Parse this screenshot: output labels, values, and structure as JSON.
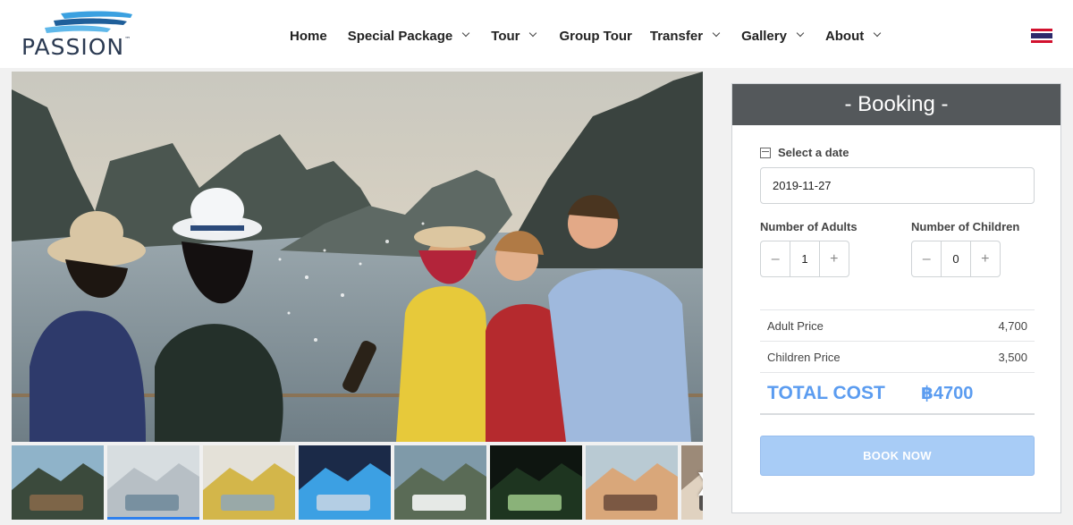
{
  "brand": {
    "name": "PASSION",
    "tm": "™"
  },
  "nav": {
    "items": [
      {
        "label": "Home",
        "dropdown": false,
        "gap": 23
      },
      {
        "label": "Special Package",
        "dropdown": true,
        "gap": 25
      },
      {
        "label": "Tour",
        "dropdown": true,
        "gap": 26
      },
      {
        "label": "Group Tour",
        "dropdown": false,
        "gap": 20
      },
      {
        "label": "Transfer",
        "dropdown": true,
        "gap": 25
      },
      {
        "label": "Gallery",
        "dropdown": true,
        "gap": 25
      },
      {
        "label": "About",
        "dropdown": true,
        "gap": 0
      }
    ],
    "language_icon": "thai-flag-icon"
  },
  "gallery": {
    "hero_icon": "photo-friends-celebrating-on-boat",
    "thumbnails": [
      {
        "icon": "photo-boat-deck-islands",
        "active": false
      },
      {
        "icon": "photo-boat-lounge",
        "active": true
      },
      {
        "icon": "photo-woman-yellow-dress",
        "active": false
      },
      {
        "icon": "photo-party-lights",
        "active": false
      },
      {
        "icon": "photo-yacht-cliffs",
        "active": false
      },
      {
        "icon": "photo-cave-night",
        "active": false
      },
      {
        "icon": "photo-woman-dining",
        "active": false
      },
      {
        "icon": "photo-partial",
        "active": false
      }
    ],
    "next_icon": "chevron-right-icon",
    "next_glyph": "❯"
  },
  "booking": {
    "title": "- Booking -",
    "date": {
      "label": "Select a date",
      "value": "2019-11-27",
      "icon": "calendar-icon"
    },
    "adults": {
      "label": "Number of Adults",
      "value": "1",
      "minus": "–",
      "plus": "+"
    },
    "children": {
      "label": "Number of Children",
      "value": "0",
      "minus": "–",
      "plus": "+"
    },
    "prices": [
      {
        "label": "Adult Price",
        "value": "4,700"
      },
      {
        "label": "Children Price",
        "value": "3,500"
      }
    ],
    "total": {
      "label": "TOTAL COST",
      "value": "฿4700"
    },
    "button": "BOOK NOW"
  },
  "colors": {
    "accent": "#5b9cf0",
    "button": "#a8ccf6",
    "header": "#54585b",
    "logo": "#2b3a52",
    "logo_wave": "#3aa0e0"
  }
}
